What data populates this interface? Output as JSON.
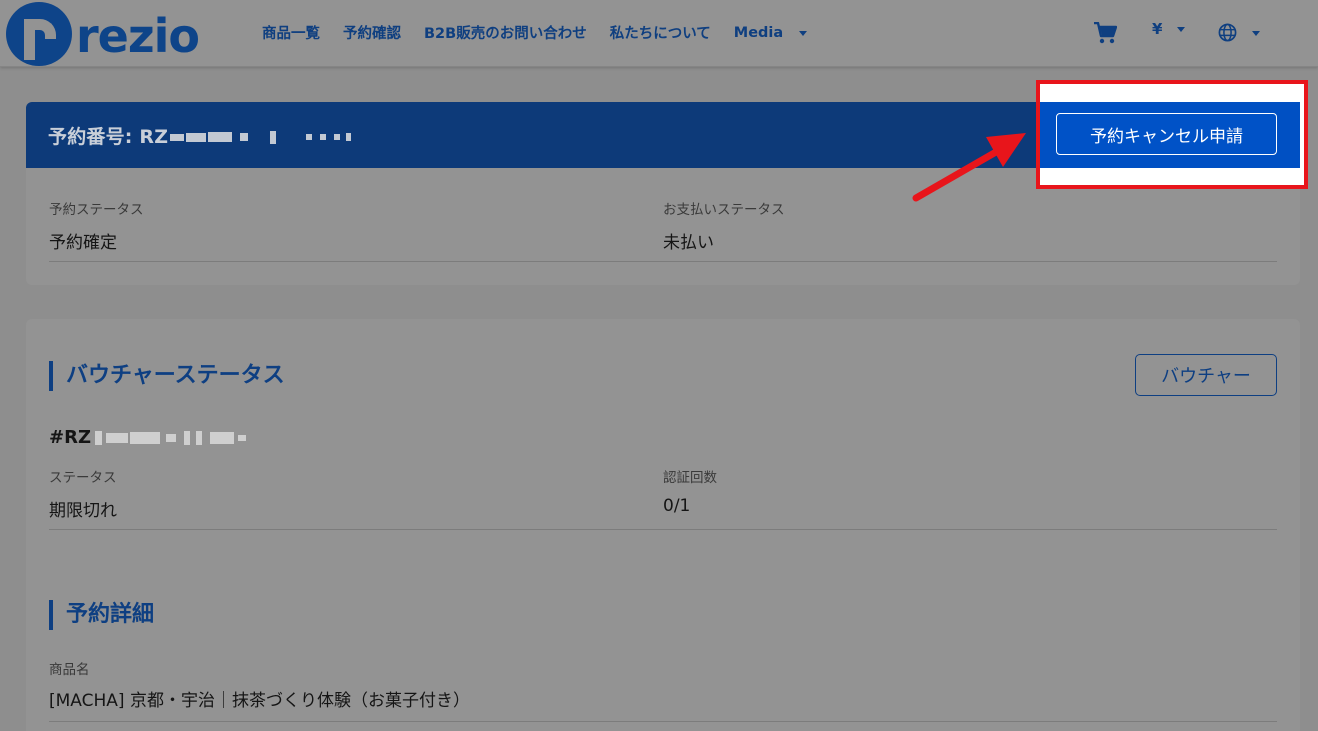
{
  "header": {
    "logo_text": "rezio",
    "nav": [
      {
        "label": "商品一覧"
      },
      {
        "label": "予約確認"
      },
      {
        "label": "B2B販売のお問い合わせ"
      },
      {
        "label": "私たちについて"
      },
      {
        "label": "Media"
      }
    ],
    "currency": "¥",
    "icons": [
      "cart-icon",
      "globe-icon",
      "chevron-down-icon"
    ]
  },
  "booking": {
    "number_label": "予約番号: RZ",
    "cancel_button": "予約キャンセル申請",
    "status_label": "予約ステータス",
    "status_value": "予約確定",
    "payment_label": "お支払いステータス",
    "payment_value": "未払い"
  },
  "voucher": {
    "section_title": "バウチャーステータス",
    "button": "バウチャー",
    "id_prefix": "#RZ",
    "status_label": "ステータス",
    "status_value": "期限切れ",
    "auth_label": "認証回数",
    "auth_value": "0/1"
  },
  "details": {
    "section_title": "予約詳細",
    "product_label": "商品名",
    "product_value": "[MACHA] 京都・宇治｜抹茶づくり体験（お菓子付き）"
  },
  "colors": {
    "brand_blue": "#0e4489",
    "button_blue": "#0052c7",
    "highlight_red": "#e8151b"
  }
}
